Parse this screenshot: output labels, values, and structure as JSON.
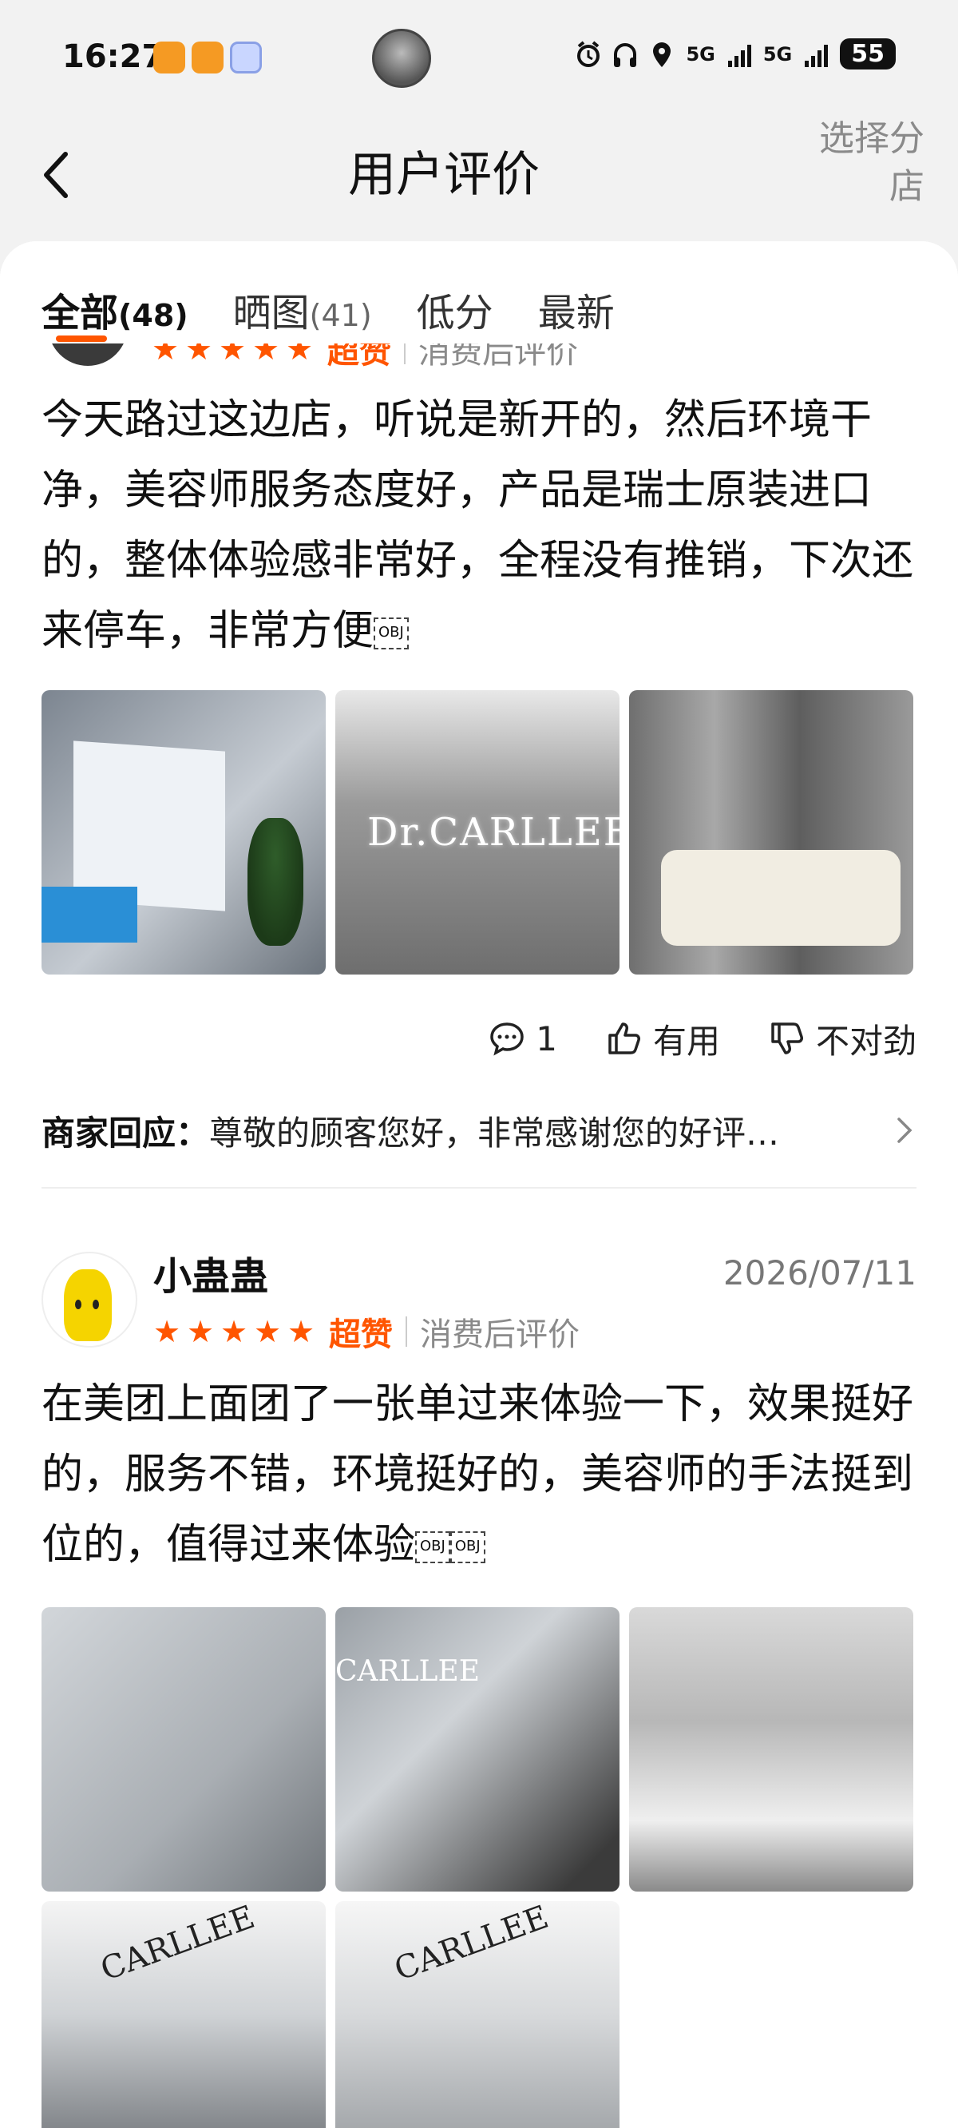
{
  "status_bar": {
    "time": "16:27",
    "network1": "5G",
    "network2": "5G",
    "battery": "55"
  },
  "header": {
    "title": "用户评价",
    "select_branch": "选择分店"
  },
  "tabs": [
    {
      "label": "全部",
      "count": "(48)",
      "active": true
    },
    {
      "label": "晒图",
      "count": "(41)",
      "active": false
    },
    {
      "label": "低分",
      "count": "",
      "active": false
    },
    {
      "label": "最新",
      "count": "",
      "active": false
    }
  ],
  "review1": {
    "rating_word": "超赞",
    "after_use": "消费后评价",
    "text": "今天路过这边店，听说是新开的，然后环境干净，美容师服务态度好，产品是瑞士原装进口的，整体体验感非常好，全程没有推销，下次还来停车，非常方便",
    "obj_marker": "OBJ",
    "photo_logo": "Dr.CARLLEE",
    "comment_count": "1",
    "useful_label": "有用",
    "wrong_label": "不对劲",
    "merchant_label": "商家回应：",
    "merchant_reply": "尊敬的顾客您好，非常感谢您的好评…"
  },
  "review2": {
    "username": "小蛊蛊",
    "date": "2026/07/11",
    "rating_word": "超赞",
    "after_use": "消费后评价",
    "text": "在美团上面团了一张单过来体验一下，效果挺好的，服务不错，环境挺好的，美容师的手法挺到位的，值得过来体验",
    "obj_marker1": "OBJ",
    "obj_marker2": "OBJ",
    "photo_logo_a": "CARLLEE",
    "photo_logo_b": "CARLLEE",
    "photo_logo_c": "CARLLEE"
  },
  "colors": {
    "accent": "#ff5500",
    "background": "#f2f2f2",
    "muted": "#8a8a8a"
  }
}
